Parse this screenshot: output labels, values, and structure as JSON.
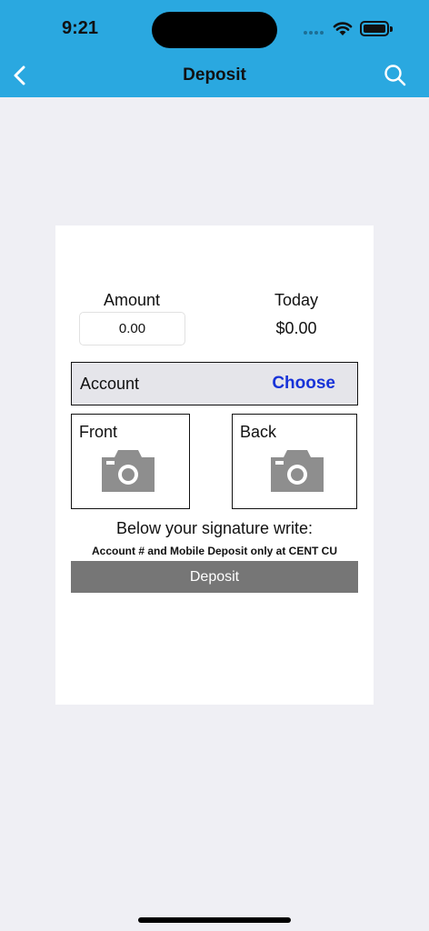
{
  "status_bar": {
    "time": "9:21"
  },
  "nav": {
    "title": "Deposit"
  },
  "form": {
    "amount_label": "Amount",
    "amount_value": "0.00",
    "today_label": "Today",
    "today_value": "$0.00",
    "account_label": "Account",
    "choose_label": "Choose",
    "front_label": "Front",
    "back_label": "Back",
    "signature_instruction": "Below your signature write:",
    "signature_note": "Account # and Mobile Deposit only at CENT CU",
    "deposit_label": "Deposit"
  },
  "colors": {
    "header": "#2aa8e0",
    "choose": "#1833d8",
    "deposit_button": "#767676",
    "background": "#efeff4"
  },
  "icons": {
    "back": "chevron-left-icon",
    "search": "search-icon",
    "camera": "camera-icon"
  }
}
